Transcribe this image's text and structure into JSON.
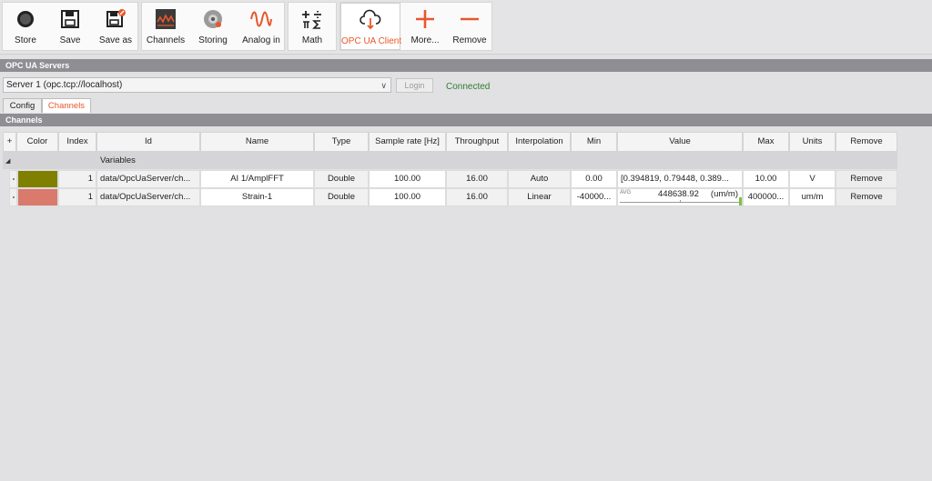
{
  "toolbar": {
    "store": "Store",
    "save": "Save",
    "save_as": "Save as",
    "channels": "Channels",
    "storing": "Storing",
    "analog_in": "Analog in",
    "math": "Math",
    "opc_ua_client": "OPC UA Client",
    "more": "More...",
    "remove": "Remove",
    "accent_color": "#e8572b"
  },
  "servers_section": {
    "title": "OPC UA Servers",
    "server_selected": "Server 1 (opc.tcp://localhost)",
    "login_label": "Login",
    "status": "Connected"
  },
  "tabs": [
    "Config",
    "Channels"
  ],
  "channels_section": {
    "title": "Channels"
  },
  "table": {
    "headers": [
      "+",
      "Color",
      "Index",
      "Id",
      "Name",
      "Type",
      "Sample rate [Hz]",
      "Throughput",
      "Interpolation",
      "Min",
      "Value",
      "Max",
      "Units",
      "Remove"
    ],
    "group_label": "Variables",
    "rows": [
      {
        "color": "#808000",
        "index": "1",
        "id": "data/OpcUaServer/ch...",
        "name": "AI 1/AmplFFT",
        "type": "Double",
        "sample_rate": "100.00",
        "throughput": "16.00",
        "interpolation": "Auto",
        "min": "0.00",
        "value": "[0.394819, 0.79448, 0.389...",
        "max": "10.00",
        "units": "V",
        "remove": "Remove"
      },
      {
        "color": "#d97a6c",
        "index": "1",
        "id": "data/OpcUaServer/ch...",
        "name": "Strain-1",
        "type": "Double",
        "sample_rate": "100.00",
        "throughput": "16.00",
        "interpolation": "Linear",
        "min": "-40000...",
        "value_avg_label": "AVG",
        "value": "448638.92",
        "value_unit": "(um/m)",
        "max": "400000...",
        "units": "um/m",
        "remove": "Remove"
      }
    ]
  }
}
